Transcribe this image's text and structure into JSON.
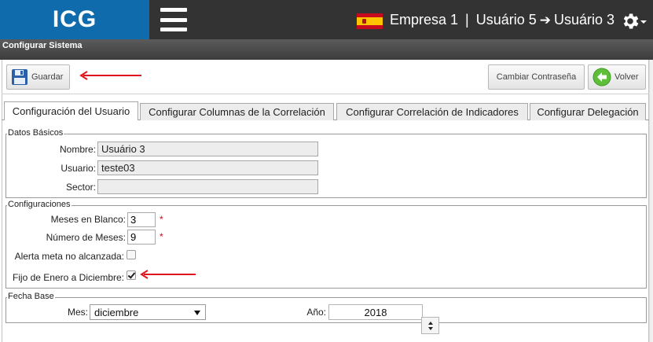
{
  "header": {
    "logo": "ICG",
    "company": "Empresa 1",
    "separator": "|",
    "user_from": "Usuário 5",
    "user_to": "Usuário 3",
    "accent_color": "#0f6bab"
  },
  "titlebar": {
    "title": "Configurar Sistema"
  },
  "toolbar": {
    "save_label": "Guardar",
    "change_password_label": "Cambiar Contraseña",
    "back_label": "Volver"
  },
  "tabs": [
    {
      "label": "Configuración del Usuario",
      "active": true
    },
    {
      "label": "Configurar Columnas de la Correlación",
      "active": false
    },
    {
      "label": "Configurar Correlación de Indicadores",
      "active": false
    },
    {
      "label": "Configurar Delegación",
      "active": false
    }
  ],
  "basic": {
    "legend": "Datos Básicos",
    "name_label": "Nombre:",
    "name_value": "Usuário 3",
    "user_label": "Usuario:",
    "user_value": "teste03",
    "sector_label": "Sector:",
    "sector_value": ""
  },
  "config": {
    "legend": "Configuraciones",
    "blank_months_label": "Meses en Blanco:",
    "blank_months_value": "3",
    "months_label": "Número de Meses:",
    "months_value": "9",
    "required_mark": "*",
    "alert_label": "Alerta meta no alcanzada:",
    "alert_checked": false,
    "fixed_label": "Fijo de Enero a Diciembre:",
    "fixed_checked": true
  },
  "base_date": {
    "legend": "Fecha Base",
    "month_label": "Mes:",
    "month_value": "diciembre",
    "year_label": "Año:",
    "year_value": "2018"
  },
  "annotation_color": "#e0141e"
}
